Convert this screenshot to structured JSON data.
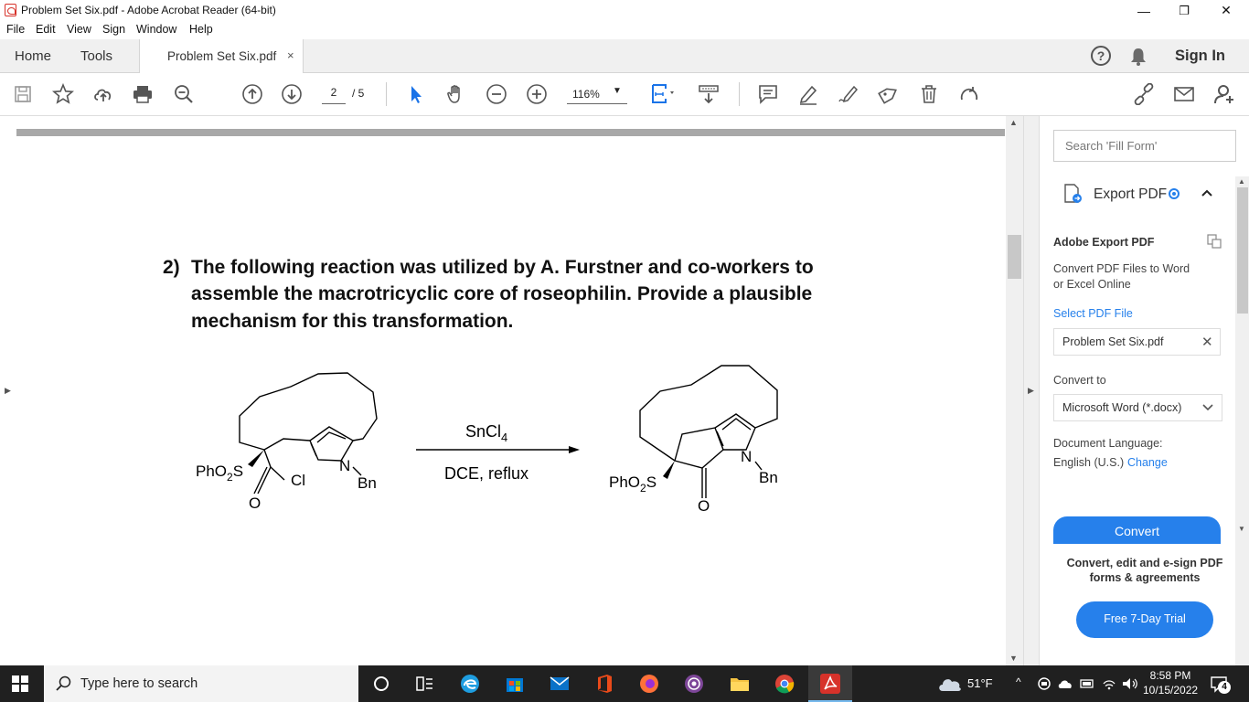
{
  "window": {
    "title": "Problem Set Six.pdf - Adobe Acrobat Reader (64-bit)",
    "minimize": "—",
    "restore": "❐",
    "close": "✕"
  },
  "menu": [
    "File",
    "Edit",
    "View",
    "Sign",
    "Window",
    "Help"
  ],
  "tabs": {
    "home": "Home",
    "tools": "Tools",
    "document": "Problem Set Six.pdf",
    "close": "×",
    "help": "?",
    "sign_in": "Sign In"
  },
  "toolbar": {
    "page_current": "2",
    "page_total": "/ 5",
    "zoom": "116%",
    "zoom_caret": "▼"
  },
  "document": {
    "question_number": "2)",
    "question_lines": [
      "The following reaction was utilized by A. Furstner and co-workers to",
      "assemble the macrotricyclic core of roseophilin. Provide a plausible",
      "mechanism for this transformation."
    ],
    "reagent": "SnCl",
    "reagent_sub": "4",
    "conditions": "DCE, reflux",
    "reactant_labels": {
      "phso2s": "PhO",
      "phso2s_sub": "2",
      "phso2s_tail": "S",
      "cl": "Cl",
      "n": "N",
      "bn": "Bn",
      "o": "O"
    },
    "product_labels": {
      "phso2s": "PhO",
      "phso2s_sub": "2",
      "phso2s_tail": "S",
      "n": "N",
      "bn": "Bn",
      "o": "O"
    }
  },
  "right_pane": {
    "search_placeholder": "Search 'Fill Form'",
    "export_title": "Export PDF",
    "heading": "Adobe Export PDF",
    "description": "Convert PDF Files to Word or Excel Online",
    "select_file": "Select PDF File",
    "file_name": "Problem Set Six.pdf",
    "convert_to": "Convert to",
    "format": "Microsoft Word (*.docx)",
    "doc_language_label": "Document Language:",
    "doc_language": "English (U.S.)",
    "change": "Change",
    "convert_button": "Convert",
    "promo": "Convert, edit and e-sign PDF forms & agreements",
    "trial_button": "Free 7-Day Trial"
  },
  "taskbar": {
    "search_placeholder": "Type here to search",
    "weather": "51°F",
    "time": "8:58 PM",
    "date": "10/15/2022",
    "notifications": "4"
  },
  "colors": {
    "accent": "#2680eb",
    "acrobat_red": "#d7322a",
    "taskbar": "#202020"
  }
}
